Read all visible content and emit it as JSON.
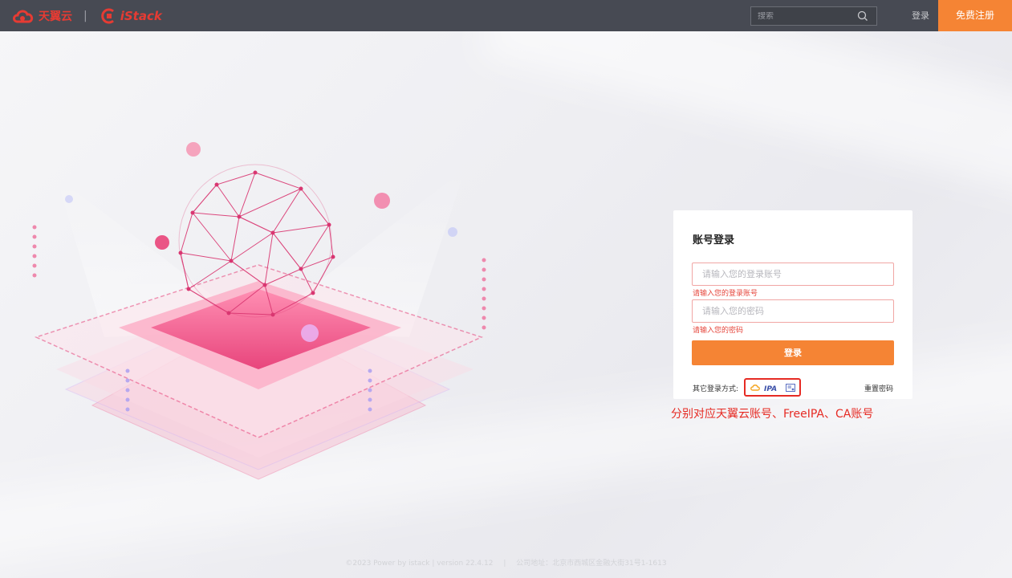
{
  "header": {
    "brand_name": "天翼云",
    "brand_separator": "|",
    "product_name": "iStack",
    "search_placeholder": "搜索",
    "login_label": "登录",
    "register_label": "免费注册"
  },
  "login": {
    "title": "账号登录",
    "account_placeholder": "请输入您的登录账号",
    "account_error": "请输入您的登录账号",
    "password_placeholder": "请输入您的密码",
    "password_error": "请输入您的密码",
    "submit_label": "登录",
    "other_methods_label": "其它登录方式:",
    "providers": [
      {
        "icon": "tianyi-cloud-icon"
      },
      {
        "icon": "freeipa-icon",
        "label": "IPA"
      },
      {
        "icon": "ca-certificate-icon"
      }
    ],
    "reset_password_label": "重置密码"
  },
  "annotation": "分别对应天翼云账号、FreeIPA、CA账号",
  "footer": {
    "copyright": "©2023 Power by istack | version 22.4.12",
    "separator": "|",
    "address": "公司地址：北京市西城区金融大街31号1-1613"
  },
  "colors": {
    "topbar": "#474a53",
    "accent_orange": "#f58434",
    "brand_red": "#e63b33",
    "error_red": "#e6473d",
    "highlight_red": "#e62b24",
    "illustration_pink": "#e8457c"
  }
}
